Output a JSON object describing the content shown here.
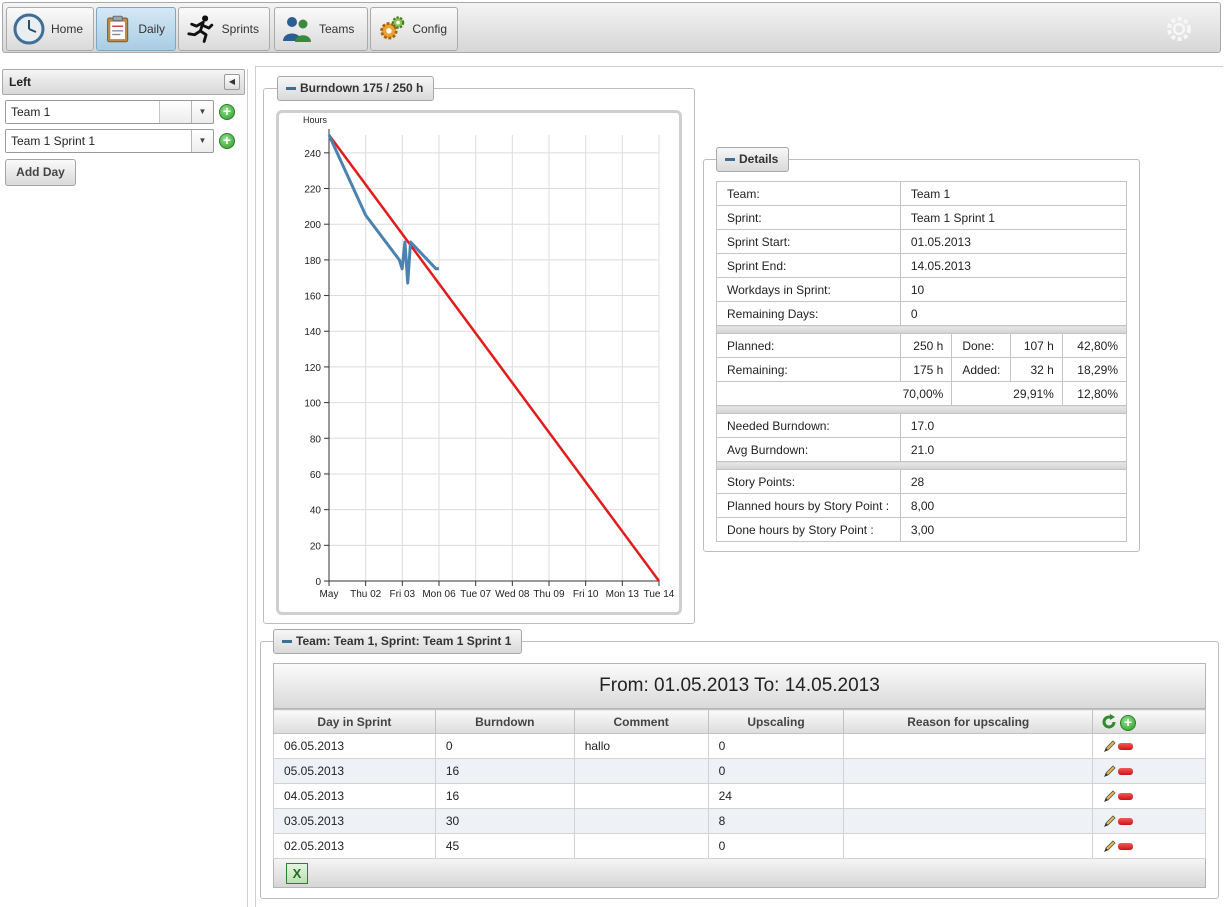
{
  "nav": {
    "items": [
      {
        "label": "Home",
        "icon": "clock-icon"
      },
      {
        "label": "Daily",
        "icon": "clipboard-icon"
      },
      {
        "label": "Sprints",
        "icon": "running-man-icon"
      },
      {
        "label": "Teams",
        "icon": "people-icon"
      },
      {
        "label": "Config",
        "icon": "gears-icon"
      }
    ],
    "active": "Daily"
  },
  "left_panel": {
    "title": "Left",
    "team_select": "Team 1",
    "sprint_select": "Team 1 Sprint 1",
    "add_day_label": "Add Day"
  },
  "burndown": {
    "legend": "Burndown 175 / 250 h"
  },
  "chart_data": {
    "type": "line",
    "ylabel": "Hours",
    "ylim": [
      0,
      250
    ],
    "y_ticks": [
      0,
      20,
      40,
      60,
      80,
      100,
      120,
      140,
      160,
      180,
      200,
      220,
      240
    ],
    "x_ticks": [
      "May",
      "Thu 02",
      "Fri 03",
      "Mon 06",
      "Tue 07",
      "Wed 08",
      "Thu 09",
      "Fri 10",
      "Mon 13",
      "Tue 14"
    ],
    "series": [
      {
        "color": "#e31b1b",
        "points": [
          [
            "May",
            250
          ],
          [
            "Tue 14",
            0
          ]
        ]
      },
      {
        "color": "#4a82b0",
        "points": [
          [
            "May",
            250
          ],
          [
            "Thu 02",
            205
          ],
          [
            "Fri 03",
            180
          ],
          [
            "Fri 03",
            175
          ],
          [
            "Fri 03",
            190
          ],
          [
            "Fri 03",
            167
          ],
          [
            "Fri 03",
            190
          ],
          [
            "Mon 06",
            175
          ],
          [
            "Mon 06",
            175
          ]
        ]
      }
    ],
    "grid": true,
    "legend": "none"
  },
  "details": {
    "legend": "Details",
    "rows": [
      {
        "label": "Team:",
        "value": "Team 1"
      },
      {
        "label": "Sprint:",
        "value": "Team 1 Sprint 1"
      },
      {
        "label": "Sprint Start:",
        "value": "01.05.2013"
      },
      {
        "label": "Sprint End:",
        "value": "14.05.2013"
      },
      {
        "label": "Workdays in Sprint:",
        "value": "10"
      },
      {
        "label": "Remaining Days:",
        "value": "0"
      }
    ],
    "planned": {
      "label": "Planned:",
      "value": "250 h",
      "done_label": "Done:",
      "done_value": "107 h",
      "done_pct": "42,80%"
    },
    "remaining": {
      "label": "Remaining:",
      "value": "175 h",
      "added_label": "Added:",
      "added_value": "32 h",
      "added_pct": "18,29%"
    },
    "pct_row": {
      "a": "70,00%",
      "b": "29,91%",
      "c": "12,80%"
    },
    "burndown_rows": [
      {
        "label": "Needed Burndown:",
        "value": "17.0"
      },
      {
        "label": "Avg Burndown:",
        "value": "21.0"
      }
    ],
    "story_rows": [
      {
        "label": "Story Points:",
        "value": "28"
      },
      {
        "label": "Planned hours by Story Point :",
        "value": "8,00"
      },
      {
        "label": "Done hours by Story Point :",
        "value": "3,00"
      }
    ]
  },
  "days": {
    "legend": "Team: Team 1, Sprint: Team 1 Sprint 1",
    "title": "From: 01.05.2013 To: 14.05.2013",
    "columns": [
      "Day in Sprint",
      "Burndown",
      "Comment",
      "Upscaling",
      "Reason for upscaling"
    ],
    "rows": [
      {
        "day": "06.05.2013",
        "burndown": "0",
        "comment": "hallo",
        "upscaling": "0",
        "reason": ""
      },
      {
        "day": "05.05.2013",
        "burndown": "16",
        "comment": "",
        "upscaling": "0",
        "reason": ""
      },
      {
        "day": "04.05.2013",
        "burndown": "16",
        "comment": "",
        "upscaling": "24",
        "reason": ""
      },
      {
        "day": "03.05.2013",
        "burndown": "30",
        "comment": "",
        "upscaling": "8",
        "reason": ""
      },
      {
        "day": "02.05.2013",
        "burndown": "45",
        "comment": "",
        "upscaling": "0",
        "reason": ""
      }
    ]
  }
}
